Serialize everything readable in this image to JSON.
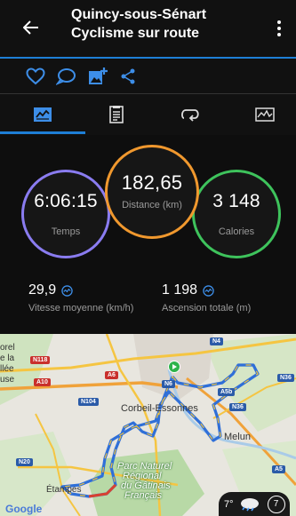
{
  "header": {
    "title": "Quincy-sous-Sénart Cyclisme sur route"
  },
  "actions": [
    {
      "name": "like-icon"
    },
    {
      "name": "comment-icon"
    },
    {
      "name": "add-photo-icon"
    },
    {
      "name": "share-icon"
    }
  ],
  "tabs": [
    {
      "name": "tab-overview",
      "icon": "chart-panel-icon",
      "selected": true
    },
    {
      "name": "tab-details",
      "icon": "document-icon",
      "selected": false
    },
    {
      "name": "tab-laps",
      "icon": "loop-icon",
      "selected": false
    },
    {
      "name": "tab-graphs",
      "icon": "graph-icon",
      "selected": false
    }
  ],
  "stats": {
    "time": {
      "value": "6:06:15",
      "label": "Temps",
      "color": "#8a7cf0"
    },
    "distance": {
      "value": "182,65",
      "label": "Distance (km)",
      "color": "#f0982e"
    },
    "calories": {
      "value": "3 148",
      "label": "Calories",
      "color": "#3ec35c"
    },
    "avg_speed": {
      "value": "29,9",
      "label": "Vitesse moyenne (km/h)"
    },
    "ascent": {
      "value": "1 198",
      "label": "Ascension totale (m)"
    }
  },
  "map": {
    "places": {
      "corbeil": "Corbeil-Essonnes",
      "melun": "Melun",
      "etampes": "Étampes",
      "parc_line1": "Parc Naturel",
      "parc_line2": "Régional",
      "parc_line3": "du Gâtinais",
      "parc_line4": "Français",
      "left1": "orel",
      "left2": "e la",
      "left3": "llée",
      "left4": "use"
    },
    "roads": {
      "n118": "N118",
      "a6": "A6",
      "n4": "N4",
      "n6": "N6",
      "a5b": "A5b",
      "n36a": "N36",
      "n36b": "N36",
      "a10": "A10",
      "n104": "N104",
      "n20": "N20",
      "a5": "A5"
    },
    "attribution": "Google",
    "weather": {
      "temperature": "7°",
      "badge": "7"
    }
  }
}
